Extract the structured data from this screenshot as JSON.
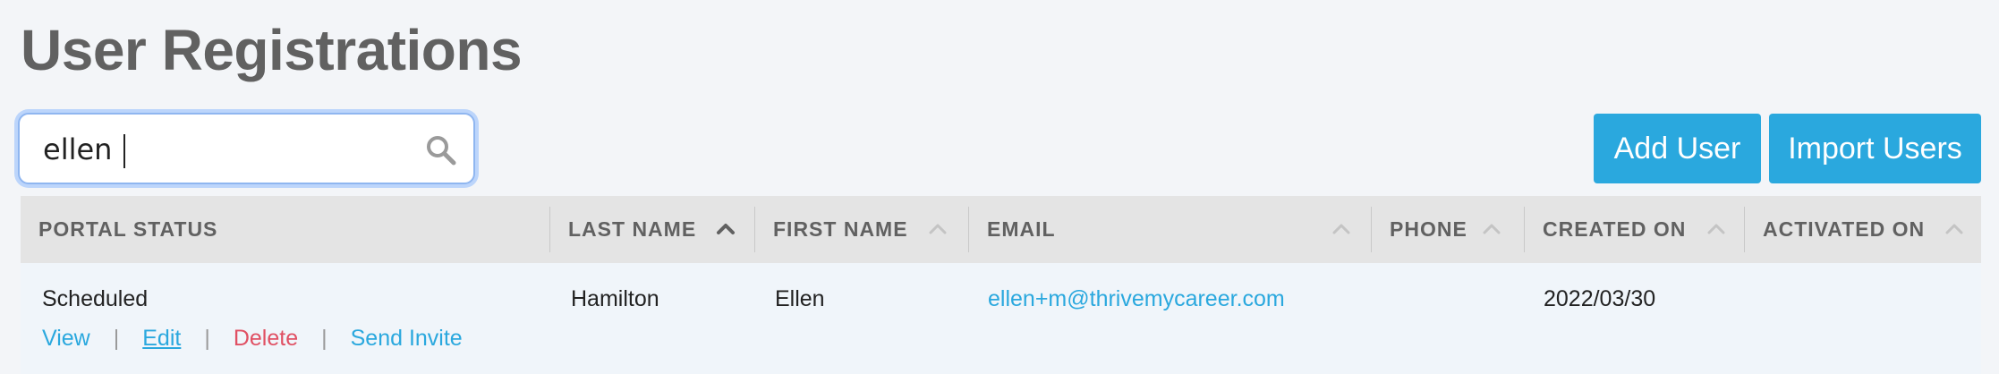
{
  "page": {
    "title": "User Registrations"
  },
  "search": {
    "value": "ellen",
    "placeholder": ""
  },
  "toolbar": {
    "add_user_label": "Add User",
    "import_users_label": "Import Users"
  },
  "table": {
    "columns": [
      {
        "label": "PORTAL STATUS",
        "sortable": false
      },
      {
        "label": "LAST NAME",
        "sortable": true,
        "sort_active": true
      },
      {
        "label": "FIRST NAME",
        "sortable": true
      },
      {
        "label": "EMAIL",
        "sortable": true
      },
      {
        "label": "PHONE",
        "sortable": true
      },
      {
        "label": "CREATED ON",
        "sortable": true
      },
      {
        "label": "ACTIVATED ON",
        "sortable": true
      }
    ],
    "rows": [
      {
        "portal_status": "Scheduled",
        "last_name": "Hamilton",
        "first_name": "Ellen",
        "email": "ellen+m@thrivemycareer.com",
        "phone": "",
        "created_on": "2022/03/30",
        "activated_on": "",
        "actions": {
          "view": "View",
          "edit": "Edit",
          "delete": "Delete",
          "send_invite": "Send Invite",
          "separator": "|"
        }
      }
    ]
  },
  "colors": {
    "accent": "#2aa8de",
    "danger": "#e05063",
    "title": "#616161",
    "header_bg": "#e4e4e4",
    "row_bg": "#f0f5fa"
  },
  "icons": {
    "search": "search-icon",
    "sort": "chevron-up-icon"
  }
}
